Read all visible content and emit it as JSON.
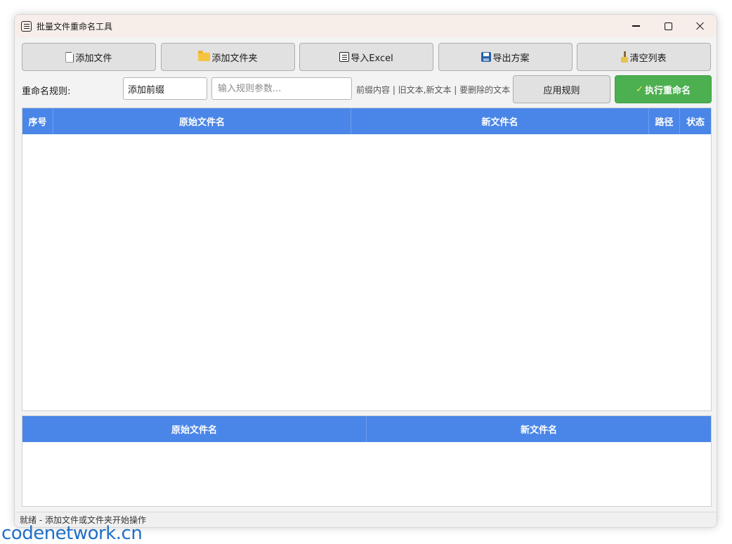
{
  "window": {
    "title": "批量文件重命名工具"
  },
  "toolbar": {
    "add_file": "添加文件",
    "add_folder": "添加文件夹",
    "import_excel": "导入Excel",
    "export_plan": "导出方案",
    "clear_list": "清空列表"
  },
  "rule": {
    "label": "重命名规则:",
    "selected": "添加前缀",
    "param_placeholder": "输入规则参数...",
    "hint": "前缀内容 | 旧文本,新文本 | 要删除的文本",
    "apply_label": "应用规则",
    "execute_label": "执行重命名",
    "execute_color": "#4caf50"
  },
  "main_table": {
    "columns": [
      "序号",
      "原始文件名",
      "新文件名",
      "路径",
      "状态"
    ],
    "rows": [],
    "header_color": "#4a86e8"
  },
  "preview_table": {
    "columns": [
      "原始文件名",
      "新文件名"
    ],
    "rows": []
  },
  "status": {
    "text": "就绪 - 添加文件或文件夹开始操作"
  },
  "watermark": "codenetwork.cn"
}
